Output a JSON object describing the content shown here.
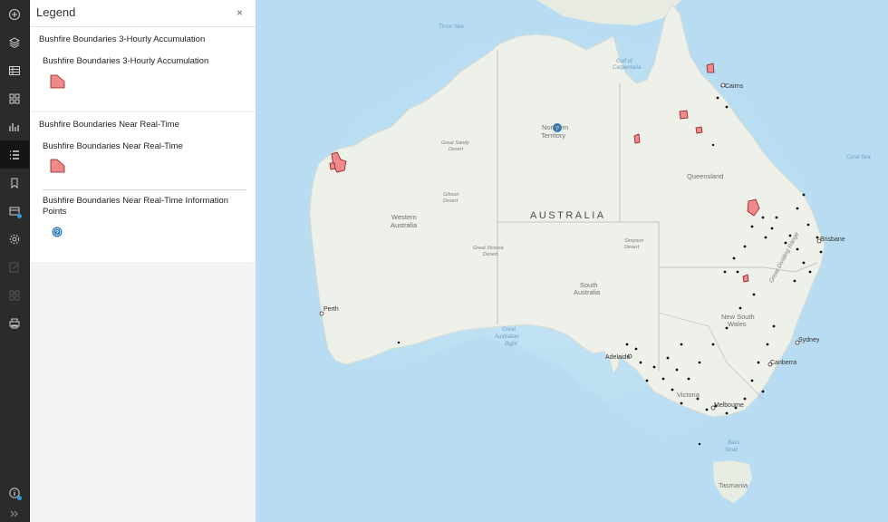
{
  "toolbar": {
    "items": [
      {
        "icon": "add-circle-icon"
      },
      {
        "icon": "layers-icon"
      },
      {
        "icon": "table-icon"
      },
      {
        "icon": "basemap-grid-icon"
      },
      {
        "icon": "chart-icon"
      },
      {
        "icon": "legend-list-icon",
        "active": true
      },
      {
        "icon": "bookmark-icon"
      },
      {
        "icon": "filter-settings-icon"
      },
      {
        "icon": "gear-icon"
      },
      {
        "icon": "edit-icon"
      },
      {
        "icon": "grid-icon"
      },
      {
        "icon": "print-icon"
      },
      {
        "icon": "info-icon"
      },
      {
        "icon": "expand-chevron-icon"
      }
    ]
  },
  "legend": {
    "title": "Legend",
    "close_glyph": "×",
    "layers": [
      {
        "layer_title": "Bushfire Boundaries 3-Hourly Accumulation",
        "symbol_label": "Bushfire Boundaries 3-Hourly Accumulation",
        "symbol_color": "#f08a8a"
      },
      {
        "layer_title": "Bushfire Boundaries Near Real-Time",
        "symbol_label": "Bushfire Boundaries Near Real-Time",
        "symbol_color": "#f08a8a"
      }
    ],
    "info_points_label": "Bushfire Boundaries Near Real-Time Information Points",
    "info_icon_color": "#2b7bbd"
  },
  "map": {
    "country_label": "AUSTRALIA",
    "water_labels": {
      "timor_sea": "Timor Sea",
      "gulf_line1": "Gulf of",
      "gulf_line2": "Carpentaria",
      "coral_sea": "Coral Sea",
      "bight_line1": "Great",
      "bight_line2": "Australian",
      "bight_line3": "Bight",
      "bass_line1": "Bass",
      "bass_line2": "Strait"
    },
    "regions": {
      "nt_line1": "Northern",
      "nt_line2": "Territory",
      "wa_line1": "Western",
      "wa_line2": "Australia",
      "qld": "Queensland",
      "sa_line1": "South",
      "sa_line2": "Australia",
      "nsw_line1": "New South",
      "nsw_line2": "Wales",
      "vic": "Victoria",
      "tas": "Tasmania"
    },
    "cities": {
      "perth": "Perth",
      "adelaide": "Adelaide",
      "melbourne": "Melbourne",
      "canberra": "Canberra",
      "sydney": "Sydney",
      "brisbane": "Brisbane",
      "cairns": "Cairns"
    },
    "deserts": {
      "gsd_line1": "Great Sandy",
      "gsd_line2": "Desert",
      "gibson_line1": "Gibson",
      "gibson_line2": "Desert",
      "gvd_line1": "Great Victoria",
      "gvd_line2": "Desert",
      "simpson_line1": "Simpson",
      "simpson_line2": "Desert"
    },
    "range_label": "Great Dividing Range",
    "colors": {
      "ocean": "#b8dcf1",
      "land": "#eef0ea",
      "fire_fill": "#f08a8a",
      "fire_outline": "#8b1a1a",
      "point": "#111111"
    }
  }
}
